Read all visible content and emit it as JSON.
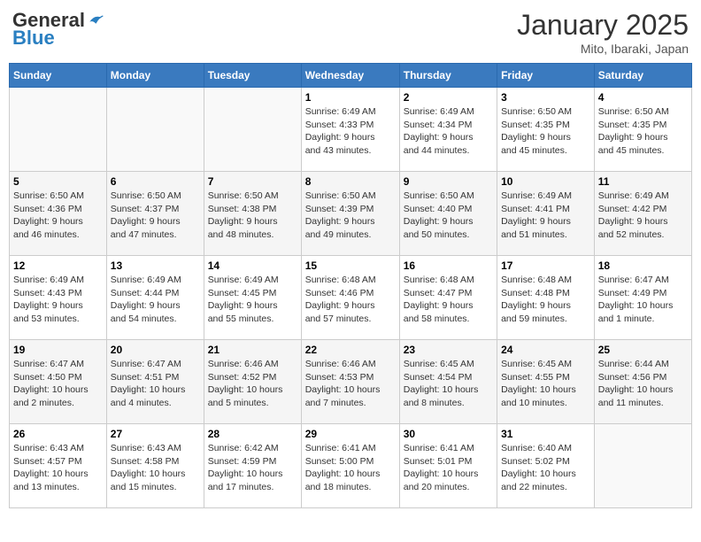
{
  "logo": {
    "general": "General",
    "blue": "Blue"
  },
  "title": "January 2025",
  "location": "Mito, Ibaraki, Japan",
  "days_of_week": [
    "Sunday",
    "Monday",
    "Tuesday",
    "Wednesday",
    "Thursday",
    "Friday",
    "Saturday"
  ],
  "weeks": [
    [
      {
        "day": "",
        "info": ""
      },
      {
        "day": "",
        "info": ""
      },
      {
        "day": "",
        "info": ""
      },
      {
        "day": "1",
        "info": "Sunrise: 6:49 AM\nSunset: 4:33 PM\nDaylight: 9 hours\nand 43 minutes."
      },
      {
        "day": "2",
        "info": "Sunrise: 6:49 AM\nSunset: 4:34 PM\nDaylight: 9 hours\nand 44 minutes."
      },
      {
        "day": "3",
        "info": "Sunrise: 6:50 AM\nSunset: 4:35 PM\nDaylight: 9 hours\nand 45 minutes."
      },
      {
        "day": "4",
        "info": "Sunrise: 6:50 AM\nSunset: 4:35 PM\nDaylight: 9 hours\nand 45 minutes."
      }
    ],
    [
      {
        "day": "5",
        "info": "Sunrise: 6:50 AM\nSunset: 4:36 PM\nDaylight: 9 hours\nand 46 minutes."
      },
      {
        "day": "6",
        "info": "Sunrise: 6:50 AM\nSunset: 4:37 PM\nDaylight: 9 hours\nand 47 minutes."
      },
      {
        "day": "7",
        "info": "Sunrise: 6:50 AM\nSunset: 4:38 PM\nDaylight: 9 hours\nand 48 minutes."
      },
      {
        "day": "8",
        "info": "Sunrise: 6:50 AM\nSunset: 4:39 PM\nDaylight: 9 hours\nand 49 minutes."
      },
      {
        "day": "9",
        "info": "Sunrise: 6:50 AM\nSunset: 4:40 PM\nDaylight: 9 hours\nand 50 minutes."
      },
      {
        "day": "10",
        "info": "Sunrise: 6:49 AM\nSunset: 4:41 PM\nDaylight: 9 hours\nand 51 minutes."
      },
      {
        "day": "11",
        "info": "Sunrise: 6:49 AM\nSunset: 4:42 PM\nDaylight: 9 hours\nand 52 minutes."
      }
    ],
    [
      {
        "day": "12",
        "info": "Sunrise: 6:49 AM\nSunset: 4:43 PM\nDaylight: 9 hours\nand 53 minutes."
      },
      {
        "day": "13",
        "info": "Sunrise: 6:49 AM\nSunset: 4:44 PM\nDaylight: 9 hours\nand 54 minutes."
      },
      {
        "day": "14",
        "info": "Sunrise: 6:49 AM\nSunset: 4:45 PM\nDaylight: 9 hours\nand 55 minutes."
      },
      {
        "day": "15",
        "info": "Sunrise: 6:48 AM\nSunset: 4:46 PM\nDaylight: 9 hours\nand 57 minutes."
      },
      {
        "day": "16",
        "info": "Sunrise: 6:48 AM\nSunset: 4:47 PM\nDaylight: 9 hours\nand 58 minutes."
      },
      {
        "day": "17",
        "info": "Sunrise: 6:48 AM\nSunset: 4:48 PM\nDaylight: 9 hours\nand 59 minutes."
      },
      {
        "day": "18",
        "info": "Sunrise: 6:47 AM\nSunset: 4:49 PM\nDaylight: 10 hours\nand 1 minute."
      }
    ],
    [
      {
        "day": "19",
        "info": "Sunrise: 6:47 AM\nSunset: 4:50 PM\nDaylight: 10 hours\nand 2 minutes."
      },
      {
        "day": "20",
        "info": "Sunrise: 6:47 AM\nSunset: 4:51 PM\nDaylight: 10 hours\nand 4 minutes."
      },
      {
        "day": "21",
        "info": "Sunrise: 6:46 AM\nSunset: 4:52 PM\nDaylight: 10 hours\nand 5 minutes."
      },
      {
        "day": "22",
        "info": "Sunrise: 6:46 AM\nSunset: 4:53 PM\nDaylight: 10 hours\nand 7 minutes."
      },
      {
        "day": "23",
        "info": "Sunrise: 6:45 AM\nSunset: 4:54 PM\nDaylight: 10 hours\nand 8 minutes."
      },
      {
        "day": "24",
        "info": "Sunrise: 6:45 AM\nSunset: 4:55 PM\nDaylight: 10 hours\nand 10 minutes."
      },
      {
        "day": "25",
        "info": "Sunrise: 6:44 AM\nSunset: 4:56 PM\nDaylight: 10 hours\nand 11 minutes."
      }
    ],
    [
      {
        "day": "26",
        "info": "Sunrise: 6:43 AM\nSunset: 4:57 PM\nDaylight: 10 hours\nand 13 minutes."
      },
      {
        "day": "27",
        "info": "Sunrise: 6:43 AM\nSunset: 4:58 PM\nDaylight: 10 hours\nand 15 minutes."
      },
      {
        "day": "28",
        "info": "Sunrise: 6:42 AM\nSunset: 4:59 PM\nDaylight: 10 hours\nand 17 minutes."
      },
      {
        "day": "29",
        "info": "Sunrise: 6:41 AM\nSunset: 5:00 PM\nDaylight: 10 hours\nand 18 minutes."
      },
      {
        "day": "30",
        "info": "Sunrise: 6:41 AM\nSunset: 5:01 PM\nDaylight: 10 hours\nand 20 minutes."
      },
      {
        "day": "31",
        "info": "Sunrise: 6:40 AM\nSunset: 5:02 PM\nDaylight: 10 hours\nand 22 minutes."
      },
      {
        "day": "",
        "info": ""
      }
    ]
  ]
}
